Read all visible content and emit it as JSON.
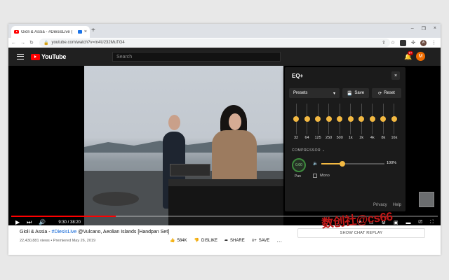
{
  "browser": {
    "tab_title": "Gioli & Assia - #DiesisLive (",
    "tab_close": "×",
    "new_tab": "+",
    "window_controls": [
      "–",
      "❐",
      "×"
    ],
    "nav": [
      "←",
      "→",
      "↻"
    ],
    "url": "youtube.com/watch?v=m4U232MuTG4",
    "profile_initial": "A"
  },
  "youtube": {
    "logo_text": "YouTube",
    "search_placeholder": "Search",
    "notification_count": "9+",
    "avatar_initial": "M"
  },
  "player": {
    "time": "9:30 / 38:20",
    "progress_fraction": 0.245
  },
  "video_info": {
    "title_prefix": "Gioli & Assia - ",
    "title_tag": "#DiesisLive",
    "title_suffix": " @Vulcano, Aeolian Islands [Handpan Set]",
    "views": "22,430,881 views • Premiered May 26, 2019",
    "likes": "584K",
    "dislike": "DISLIKE",
    "share": "SHARE",
    "save": "SAVE",
    "more": "…",
    "chat_replay": "SHOW CHAT REPLAY"
  },
  "eq": {
    "title": "EQ+",
    "close": "×",
    "presets": "Presets",
    "save": "Save",
    "reset": "Reset",
    "bands": [
      "32",
      "64",
      "125",
      "250",
      "500",
      "1k",
      "2k",
      "4k",
      "8k",
      "16k"
    ],
    "compressor": "COMPRESSOR",
    "pan_value": "0.00",
    "pan_label": "Pan",
    "volume": "100%",
    "volume_fraction": 0.33,
    "mono": "Mono",
    "privacy": "Privacy",
    "help": "Help",
    "accent_color": "#f3b942"
  },
  "watermark": "数创社@cs66"
}
